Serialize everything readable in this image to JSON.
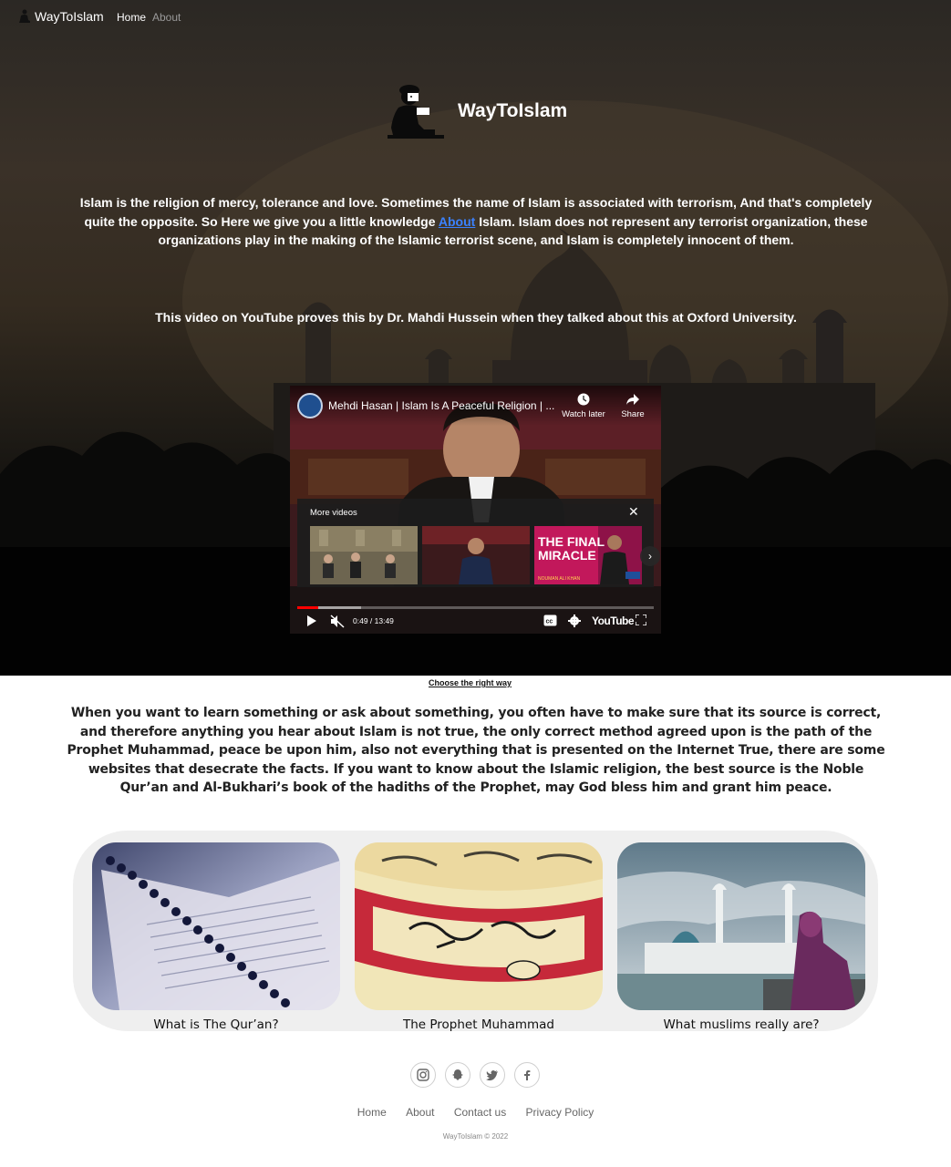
{
  "nav": {
    "brand": "WayToIslam",
    "links": [
      "Home",
      "About"
    ]
  },
  "hero": {
    "logo_title": "WayToIslam",
    "intro_before": "Islam is the religion of mercy, tolerance and love. Sometimes the name of Islam is associated with terrorism, And that's completely quite the opposite. So Here we give you a little knowledge ",
    "intro_link": "About",
    "intro_after": " Islam. Islam does not represent any terrorist organization, these organizations play in the making of the Islamic terrorist scene, and Islam is completely innocent of them.",
    "video_note": "This video on YouTube proves this by Dr. Mahdi Hussein when they talked about this at Oxford University."
  },
  "video": {
    "title": "Mehdi Hasan | Islam Is A Peaceful Religion | ...",
    "watch_later": "Watch later",
    "share": "Share",
    "more_videos": "More videos",
    "thumb3_line1": "THE FINAL",
    "thumb3_line2": "MIRACLE",
    "thumb3_sub": "NOUMAN ALI KHAN",
    "time": "0:49 / 13:49",
    "logo": "YouTube",
    "progress": 0.0592
  },
  "section": {
    "right_way": "Choose the right way",
    "body": "When you want to learn something or ask about something, you often have to make sure that its source is correct, and therefore anything you hear about Islam is not true, the only correct method agreed upon is the path of the Prophet Muhammad, peace be upon him, also not everything that is presented on the Internet True, there are some websites that desecrate the facts. If you want to know about the Islamic religion, the best source is the Noble Qur’an and Al-Bukhari’s book of the hadiths of the Prophet, may God bless him and grant him peace."
  },
  "cards": [
    {
      "label": "What is The Qur’an?"
    },
    {
      "label": "The Prophet Muhammad"
    },
    {
      "label": "What muslims really are?"
    }
  ],
  "footer": {
    "social_icons": [
      "instagram-icon",
      "snapchat-icon",
      "twitter-icon",
      "facebook-icon"
    ],
    "links": [
      "Home",
      "About",
      "Contact us",
      "Privacy Policy"
    ],
    "copyright": "WayToIslam © 2022"
  }
}
